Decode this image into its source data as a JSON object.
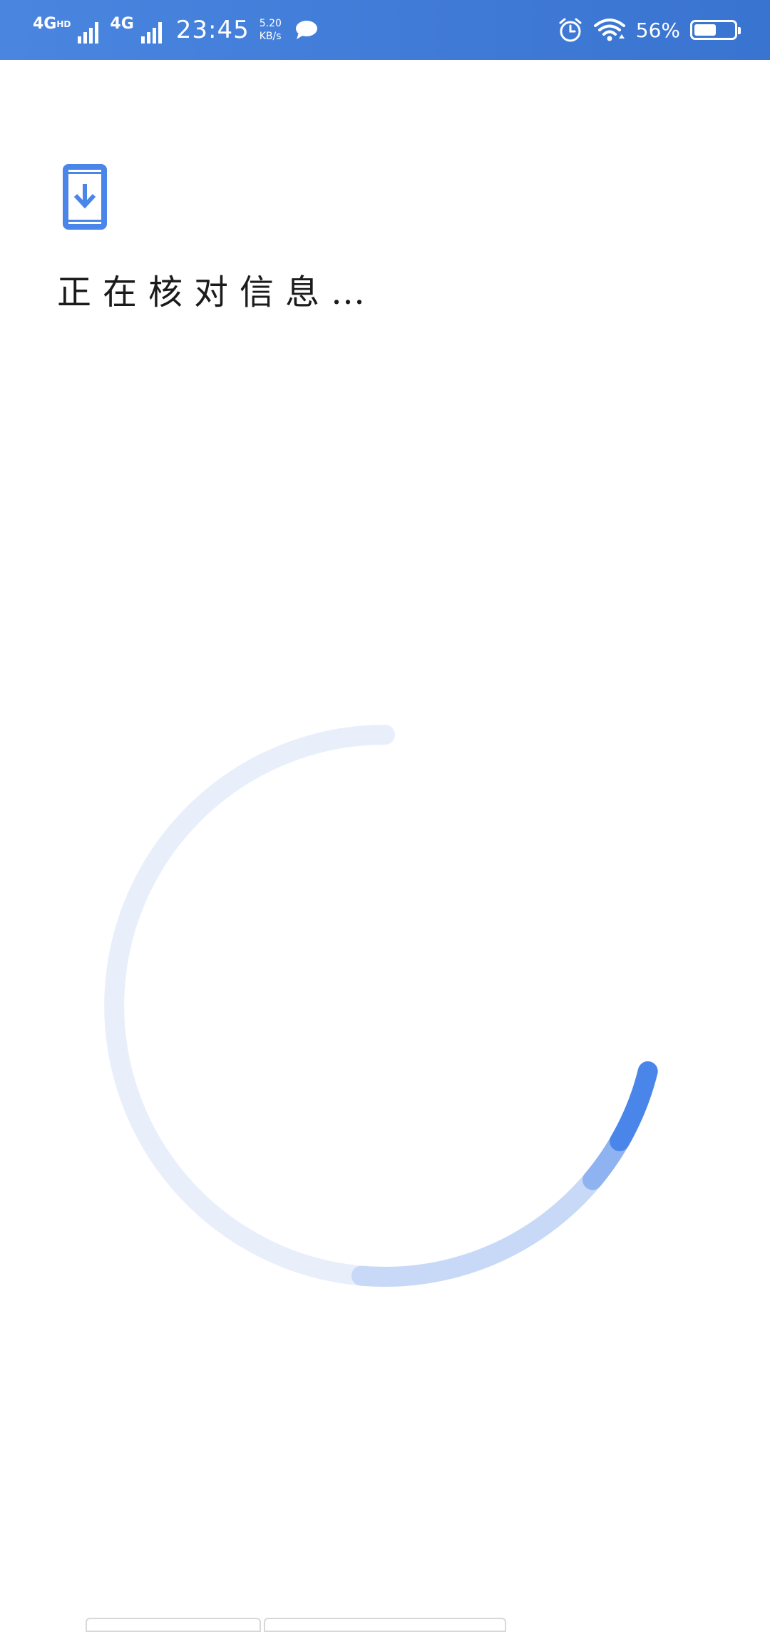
{
  "status_bar": {
    "network_1": "4G",
    "network_1_suffix": "HD",
    "network_2": "4G",
    "time": "23:45",
    "speed_value": "5.20",
    "speed_unit": "KB/s",
    "battery_percent": "56%",
    "battery_level": 0.56,
    "icons": [
      "message-icon",
      "alarm-icon",
      "wifi-icon",
      "battery-icon"
    ]
  },
  "main": {
    "icon": "phone-download-icon",
    "title": "正在核对信息…"
  },
  "spinner": {
    "track_color": "#e8effb",
    "tail_color": "#c7d9f7",
    "mid_color": "#8fb3f0",
    "head_color": "#4a86ea"
  },
  "colors": {
    "status_bar": "#3f7ad6",
    "accent": "#4a86ea",
    "text": "#1b1b1b"
  }
}
